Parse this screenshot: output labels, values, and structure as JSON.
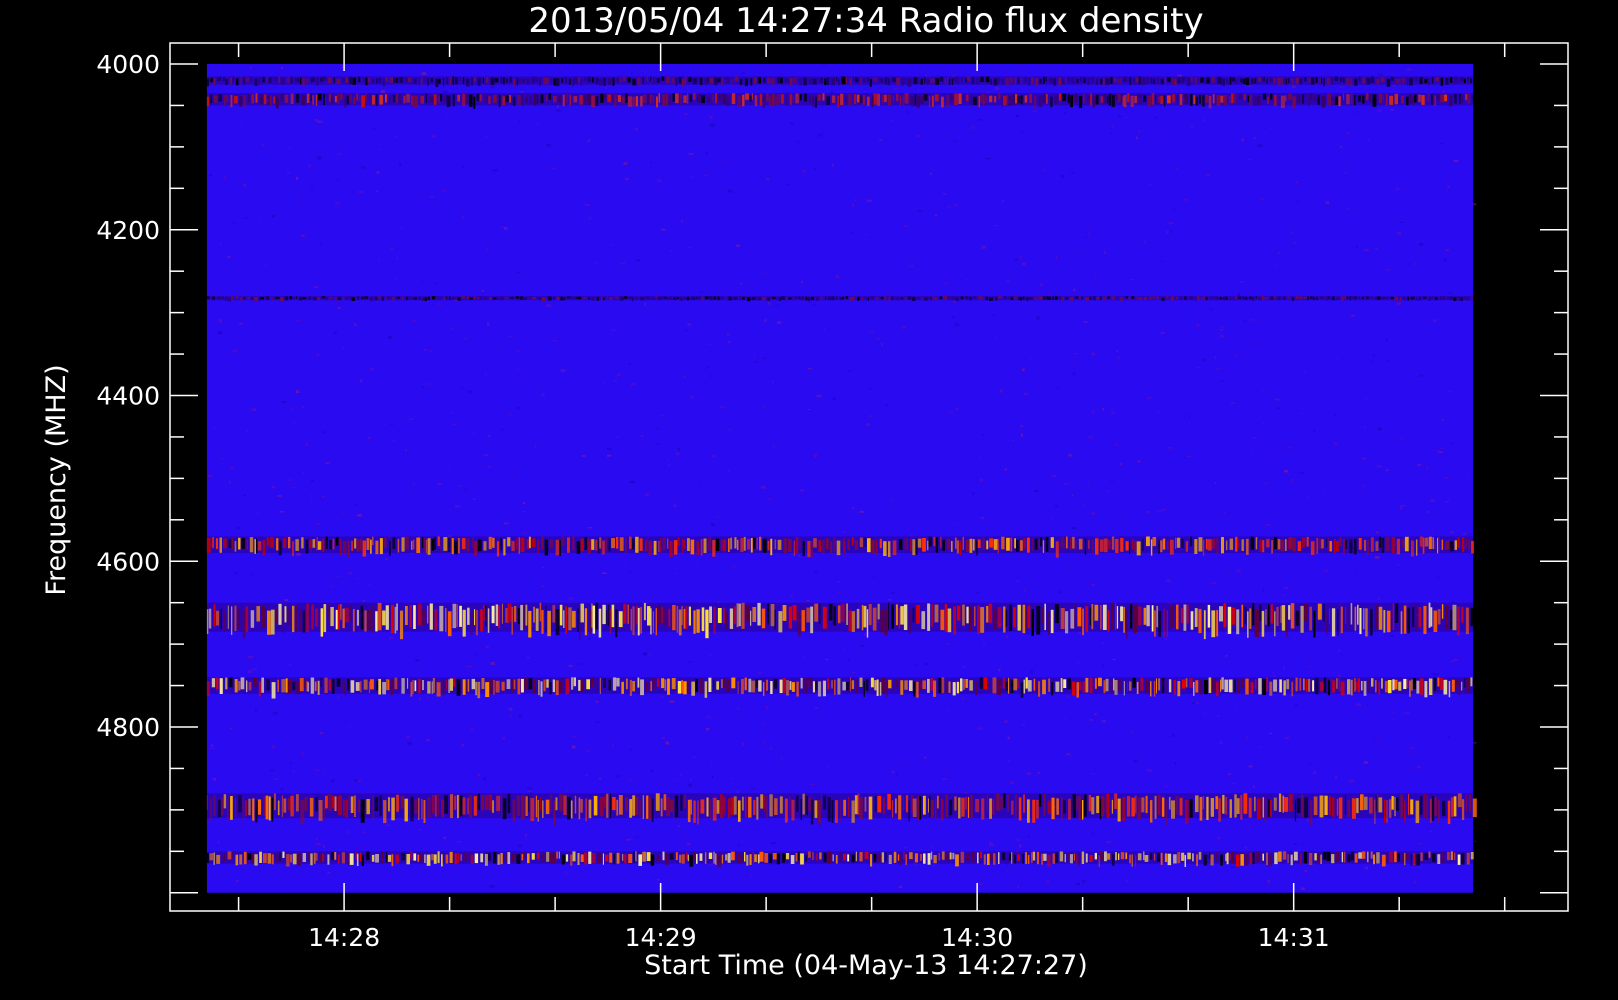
{
  "chart_data": {
    "type": "heatmap",
    "title": "2013/05/04 14:27:34 Radio flux density",
    "xlabel": "Start Time (04-May-13 14:27:27)",
    "ylabel": "Frequency (MHZ)",
    "x_ticks": [
      "14:28",
      "14:29",
      "14:30",
      "14:31"
    ],
    "x_tick_values": [
      "14:28:00",
      "14:29:00",
      "14:30:00",
      "14:31:00"
    ],
    "y_ticks": [
      4000,
      4200,
      4400,
      4600,
      4800
    ],
    "ylim": [
      4000,
      5000
    ],
    "xlim": [
      "14:27:27",
      "14:31:52"
    ],
    "data_extent_x": [
      "14:27:34",
      "14:31:34"
    ],
    "data_extent_y": [
      4000,
      5000
    ],
    "colormap": "blue-red-yellow",
    "background_color": "#000000",
    "axis_color": "#ffffff",
    "cell_color": "#2a0af0",
    "bands": [
      {
        "freq_from": 4015,
        "freq_to": 4025,
        "intensity": "black"
      },
      {
        "freq_from": 4035,
        "freq_to": 4050,
        "intensity": "red"
      },
      {
        "freq_from": 4280,
        "freq_to": 4285,
        "intensity": "black"
      },
      {
        "freq_from": 4570,
        "freq_to": 4590,
        "intensity": "orange"
      },
      {
        "freq_from": 4650,
        "freq_to": 4685,
        "intensity": "yellow"
      },
      {
        "freq_from": 4740,
        "freq_to": 4760,
        "intensity": "yellow"
      },
      {
        "freq_from": 4880,
        "freq_to": 4910,
        "intensity": "orange"
      },
      {
        "freq_from": 4950,
        "freq_to": 4965,
        "intensity": "yellow"
      }
    ]
  }
}
